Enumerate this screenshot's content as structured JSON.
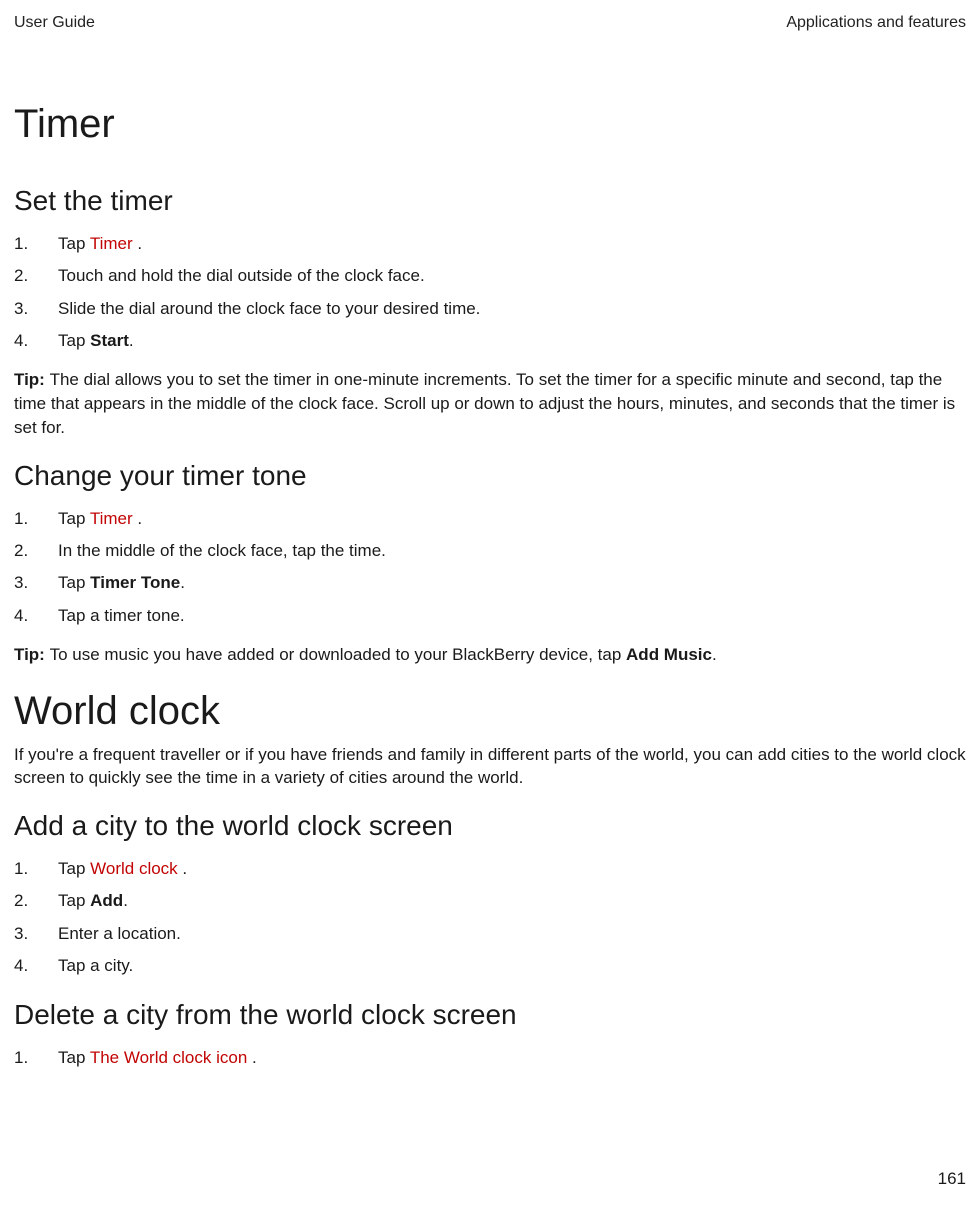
{
  "header": {
    "left": "User Guide",
    "right": "Applications and features"
  },
  "h1": "Timer",
  "section1": {
    "heading": "Set the timer",
    "steps": [
      {
        "n": "1.",
        "pre": "Tap  ",
        "red": "Timer",
        "post": " ."
      },
      {
        "n": "2.",
        "text": "Touch and hold the dial outside of the clock face."
      },
      {
        "n": "3.",
        "text": "Slide the dial around the clock face to your desired time."
      },
      {
        "n": "4.",
        "pre": "Tap ",
        "bold": "Start",
        "post": "."
      }
    ],
    "tipLabel": "Tip: ",
    "tipText": "The dial allows you to set the timer in one-minute increments. To set the timer for a specific minute and second, tap the time that appears in the middle of the clock face. Scroll up or down to adjust the hours, minutes, and seconds that the timer is set for."
  },
  "section2": {
    "heading": "Change your timer tone",
    "steps": [
      {
        "n": "1.",
        "pre": "Tap  ",
        "red": "Timer",
        "post": " ."
      },
      {
        "n": "2.",
        "text": "In the middle of the clock face, tap the time."
      },
      {
        "n": "3.",
        "pre": "Tap ",
        "bold": "Timer Tone",
        "post": "."
      },
      {
        "n": "4.",
        "text": "Tap a timer tone."
      }
    ],
    "tipLabel": "Tip: ",
    "tipPre": "To use music you have added or downloaded to your BlackBerry device, tap ",
    "tipBold": "Add Music",
    "tipPost": "."
  },
  "h2": "World clock",
  "intro": "If you're a frequent traveller or if you have friends and family in different parts of the world, you can add cities to the world clock screen to quickly see the time in a variety of cities around the world.",
  "section3": {
    "heading": "Add a city to the world clock screen",
    "steps": [
      {
        "n": "1.",
        "pre": "Tap  ",
        "red": "World clock",
        "post": " ."
      },
      {
        "n": "2.",
        "pre": "Tap ",
        "bold": "Add",
        "post": "."
      },
      {
        "n": "3.",
        "text": "Enter a location."
      },
      {
        "n": "4.",
        "text": "Tap a city."
      }
    ]
  },
  "section4": {
    "heading": "Delete a city from the world clock screen",
    "steps": [
      {
        "n": "1.",
        "pre": "Tap  ",
        "red": "The World clock icon",
        "post": " ."
      }
    ]
  },
  "pageNumber": "161"
}
